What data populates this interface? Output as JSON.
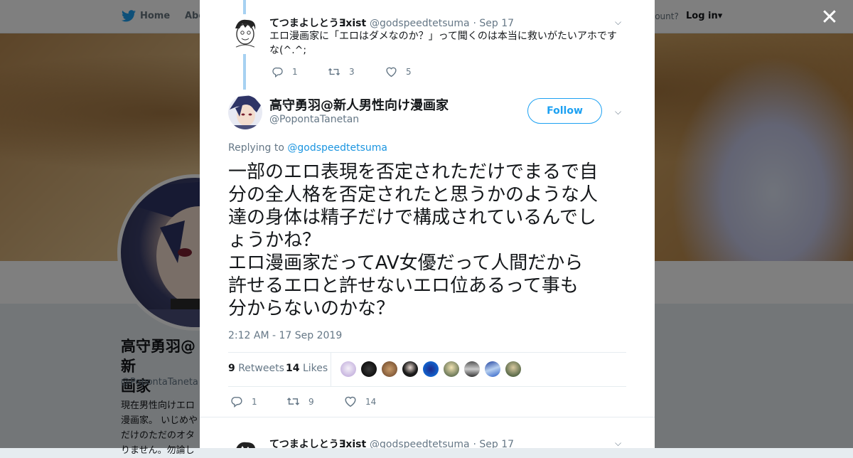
{
  "topnav": {
    "home_label": "Home",
    "about_label": "Abo",
    "account_label": "ccount?",
    "login_label": "Log in▾"
  },
  "background_profile": {
    "name_line1": "高守勇羽@新",
    "name_line2": "画家",
    "handle": "@PopontaTaneta",
    "bio_lines": [
      "現在男性向けエロ",
      "漫画家。 いじめや",
      "だけのただのオタ",
      "りません。勿論し"
    ]
  },
  "prev_tweet": {
    "name": "てつまよしとうƎxist",
    "handle": "@godspeedtetsuma",
    "date": "· Sep 17",
    "text_line1": "エロ漫画家に「エロはダメなのか？」って聞くのは本当に救いがたいアホです",
    "text_line2": "な(^.^;",
    "replies": "1",
    "retweets": "3",
    "likes": "5"
  },
  "main_tweet": {
    "name": "高守勇羽@新人男性向け漫画家",
    "handle": "@PopontaTanetan",
    "follow_label": "Follow",
    "replying_prefix": "Replying to ",
    "replying_to": "@godspeedtetsuma",
    "text_lines": [
      "一部のエロ表現を否定されただけでまるで自",
      "分の全人格を否定されたと思うかのような人",
      "達の身体は精子だけで構成されているんでし",
      "ょうかね？",
      "エロ漫画家だってAV女優だって人間だから",
      "許せるエロと許せないエロ位あるって事も",
      "分からないのかな？"
    ],
    "timestamp": "2:12 AM - 17 Sep 2019",
    "retweet_count": "9",
    "retweet_label": "Retweets",
    "like_count": "14",
    "like_label": "Likes",
    "replies": "1",
    "retweets": "9",
    "likes": "14"
  },
  "next_tweet": {
    "name": "てつまよしとうƎxist",
    "handle": "@godspeedtetsuma",
    "date": "· Sep 17"
  },
  "colors": {
    "accent": "#1da1f2",
    "link": "#1b95e0",
    "thread_line": "#a6d1f1"
  },
  "icons": {
    "close": "close-icon",
    "reply": "reply-icon",
    "retweet": "retweet-icon",
    "like": "heart-icon",
    "chevron": "chevron-down-icon",
    "bird": "twitter-bird-icon"
  }
}
